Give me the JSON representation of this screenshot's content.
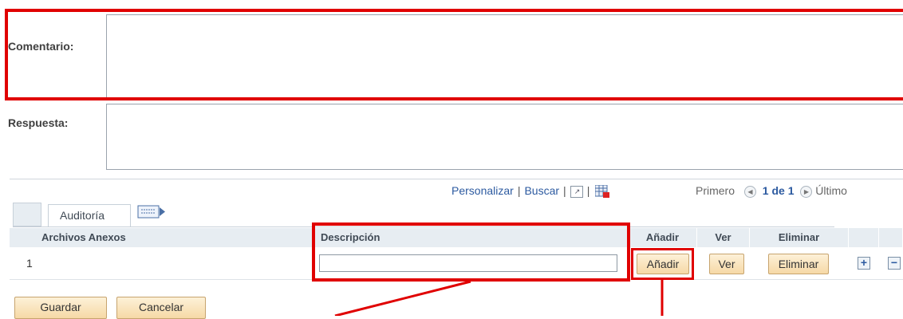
{
  "form": {
    "comentario_label": "Comentario:",
    "respuesta_label": "Respuesta:"
  },
  "grid": {
    "toolbar": {
      "personalizar": "Personalizar",
      "buscar": "Buscar",
      "sep": "|",
      "primero": "Primero",
      "page_info": "1 de 1",
      "ultimo": "Último"
    },
    "tab_label": "Auditoría",
    "columns": {
      "archivos": "Archivos Anexos",
      "descripcion": "Descripción",
      "anadir": "Añadir",
      "ver": "Ver",
      "eliminar": "Eliminar"
    },
    "rows": [
      {
        "number": "1",
        "descripcion_value": "",
        "anadir_button": "Añadir",
        "ver_button": "Ver",
        "eliminar_button": "Eliminar"
      }
    ]
  },
  "footer": {
    "guardar": "Guardar",
    "cancelar": "Cancelar"
  },
  "colors": {
    "highlight": "#e00000",
    "link": "#2c5aa0",
    "button_bg": "#f6d9a6",
    "header_bg": "#e7edf2"
  }
}
